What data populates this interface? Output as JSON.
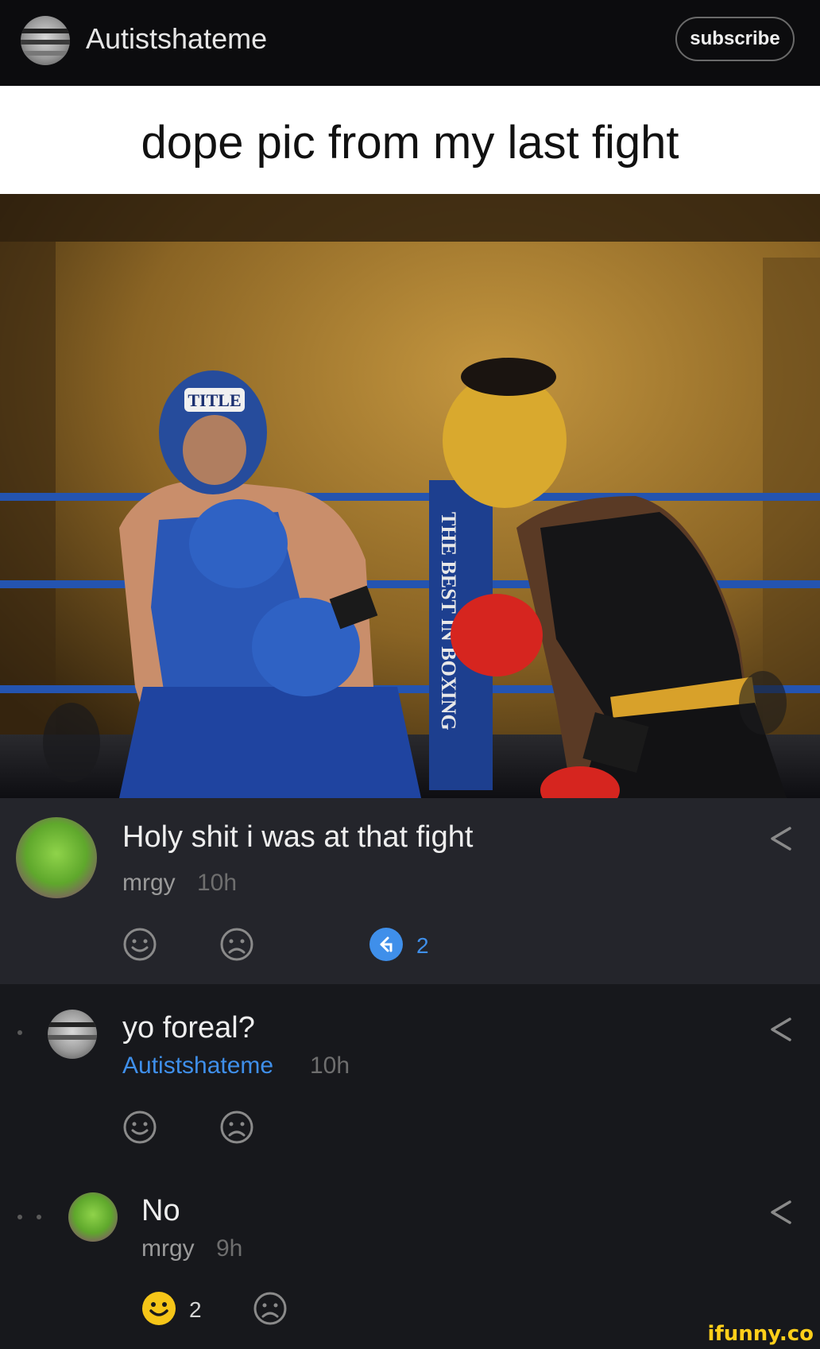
{
  "header": {
    "username": "Autistshateme",
    "subscribe_label": "subscribe"
  },
  "post": {
    "title": "dope pic from my last fight",
    "photo_sign_text": "THE BEST IN BOXING",
    "headgear_text": "TITLE"
  },
  "comments": [
    {
      "text": "Holy shit i was at that fight",
      "user": "mrgy",
      "time": "10h",
      "reply_count": "2",
      "avatar_icon": "green-mask-avatar-icon"
    },
    {
      "text": "yo foreal?",
      "user": "Autistshateme",
      "time": "10h",
      "avatar_icon": "user-avatar-icon"
    },
    {
      "text": "No",
      "user": "mrgy",
      "time": "9h",
      "smile_count": "2",
      "avatar_icon": "green-mask-avatar-icon"
    }
  ],
  "watermark": "ifunny.co",
  "colors": {
    "op_username": "#3f8fea",
    "reply_badge": "#3f8fea",
    "active_smile": "#f5c518"
  }
}
